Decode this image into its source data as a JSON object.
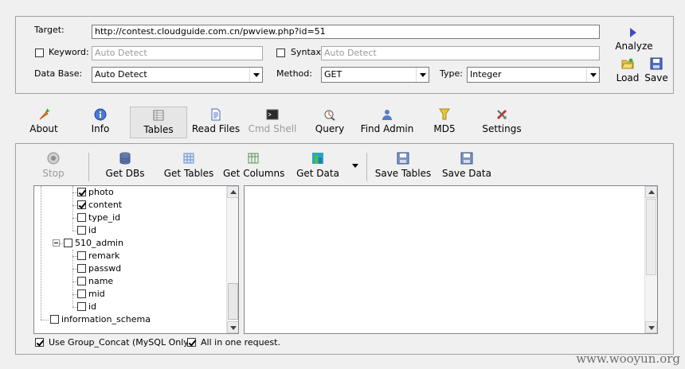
{
  "target": {
    "label": "Target:",
    "value": "http://contest.cloudguide.com.cn/pwview.php?id=51"
  },
  "keyword": {
    "label": "Keyword:",
    "placeholder": "Auto Detect",
    "checked": false
  },
  "syntax": {
    "label": "Syntax:",
    "placeholder": "Auto Detect",
    "checked": false
  },
  "database": {
    "label": "Data Base:",
    "selected": "Auto Detect"
  },
  "method": {
    "label": "Method:",
    "selected": "GET"
  },
  "type": {
    "label": "Type:",
    "selected": "Integer"
  },
  "actions": {
    "analyze": "Analyze",
    "load": "Load",
    "save": "Save"
  },
  "tabs": [
    {
      "label": "About",
      "icon": "carrot-icon"
    },
    {
      "label": "Info",
      "icon": "info-icon"
    },
    {
      "label": "Tables",
      "icon": "table-icon",
      "active": true
    },
    {
      "label": "Read Files",
      "icon": "document-icon"
    },
    {
      "label": "Cmd Shell",
      "icon": "terminal-icon",
      "disabled": true
    },
    {
      "label": "Query",
      "icon": "query-icon"
    },
    {
      "label": "Find Admin",
      "icon": "user-icon"
    },
    {
      "label": "MD5",
      "icon": "key-icon"
    },
    {
      "label": "Settings",
      "icon": "tools-icon"
    }
  ],
  "toolbar": {
    "stop": "Stop",
    "get_dbs": "Get DBs",
    "get_tables": "Get Tables",
    "get_columns": "Get Columns",
    "get_data": "Get Data",
    "save_tables": "Save Tables",
    "save_data": "Save Data"
  },
  "tree": [
    {
      "label": "photo",
      "checked": true
    },
    {
      "label": "content",
      "checked": true
    },
    {
      "label": "type_id",
      "checked": false
    },
    {
      "label": "id",
      "checked": false
    },
    {
      "label": "510_admin",
      "checked": false
    },
    {
      "label": "remark",
      "checked": false
    },
    {
      "label": "passwd",
      "checked": false
    },
    {
      "label": "name",
      "checked": false
    },
    {
      "label": "mid",
      "checked": false
    },
    {
      "label": "id",
      "checked": false
    },
    {
      "label": "information_schema",
      "checked": false
    }
  ],
  "options": {
    "group_concat": {
      "label": "Use Group_Concat (MySQL Only)",
      "checked": true
    },
    "all_in_one": {
      "label": "All in one request.",
      "checked": true
    }
  },
  "watermark": "www.wooyun.org"
}
